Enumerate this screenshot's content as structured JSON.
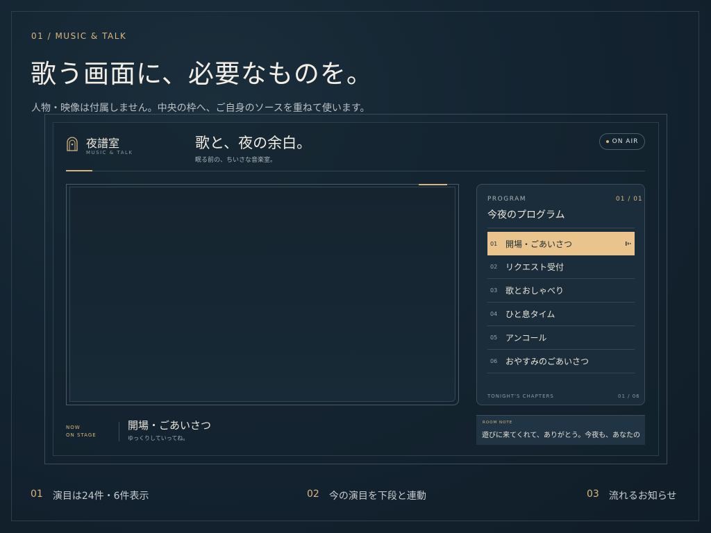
{
  "intro": {
    "eyebrow": "01 / MUSIC & TALK",
    "headline": "歌う画面に、必要なものを。",
    "subline": "人物・映像は付属しません。中央の枠へ、ご自身のソースを重ねて使います。"
  },
  "app": {
    "brand_name": "夜譜室",
    "brand_sub": "MUSIC & TALK",
    "header_title": "歌と、夜の余白。",
    "header_sub": "眠る前の、ちいさな音楽室。",
    "status_badge": "ON AIR",
    "brand_icon": "arch-window-icon"
  },
  "program": {
    "label": "PROGRAM",
    "count": "01 / 01",
    "title": "今夜のプログラム",
    "items": [
      {
        "num": "01",
        "name": "開場・ごあいさつ",
        "active": true
      },
      {
        "num": "02",
        "name": "リクエスト受付",
        "active": false
      },
      {
        "num": "03",
        "name": "歌とおしゃべり",
        "active": false
      },
      {
        "num": "04",
        "name": "ひと息タイム",
        "active": false
      },
      {
        "num": "05",
        "name": "アンコール",
        "active": false
      },
      {
        "num": "06",
        "name": "おやすみのごあいさつ",
        "active": false
      }
    ],
    "chapters_label": "TONIGHT'S CHAPTERS",
    "chapters_count": "01 / 06"
  },
  "now": {
    "label": "NOW\nON STAGE",
    "title": "開場・ごあいさつ",
    "sub": "ゆっくりしていってね。"
  },
  "room_note": {
    "label": "ROOM NOTE",
    "text": "遊びに来てくれて、ありがとう。今夜も、あなたの"
  },
  "features": [
    {
      "num": "01",
      "text": "演目は24件・6件表示"
    },
    {
      "num": "02",
      "text": "今の演目を下段と連動"
    },
    {
      "num": "03",
      "text": "流れるお知らせ"
    }
  ],
  "colors": {
    "accent": "#d8b67e",
    "active_row": "#e9c48c",
    "background": "#142431"
  }
}
